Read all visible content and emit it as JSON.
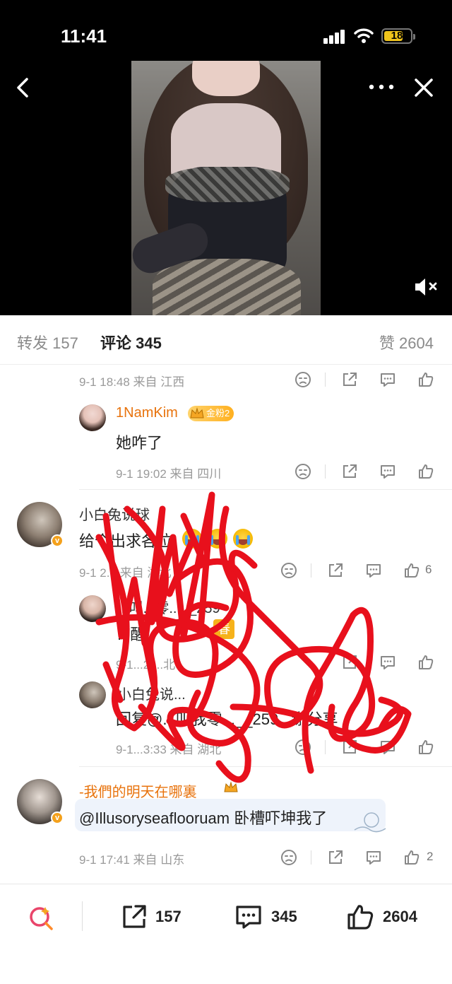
{
  "status_bar": {
    "time": "11:41",
    "battery": "18"
  },
  "tabs": {
    "repost": {
      "label": "转发",
      "count": "157"
    },
    "comments": {
      "label": "评论",
      "count": "345"
    },
    "likes": {
      "label": "赞",
      "count": "2604"
    }
  },
  "comments": [
    {
      "meta": "9-1 18:48 来自 江西"
    },
    {
      "user": "1NamKim",
      "fan_badge": "金粉2",
      "text": "她咋了",
      "meta": "9-1 19:02 来自 四川"
    },
    {
      "user": "小白兔说球",
      "text": "给个出求各位",
      "meta": "9-1 2... 来自 湖北",
      "likes": "6",
      "replies": [
        {
          "user": "...叫...零...__259",
          "text": "...醒",
          "meta": "9-1...2 ...北"
        },
        {
          "user": "小白兔说...",
          "text": "回复@...叫我零...__259...谢分享",
          "meta": "9-1...3:33 来自 湖北"
        }
      ]
    },
    {
      "user": "-我們的明天在哪裏",
      "text": "@Illusoryseaflooruam 卧槽吓坤我了",
      "meta": "9-1 17:41 来自 山东",
      "likes": "2"
    }
  ],
  "bottom_bar": {
    "repost_count": "157",
    "comment_count": "345",
    "like_count": "2604"
  },
  "colors": {
    "accent_orange": "#e8730d",
    "fan_gold": "#ffb020",
    "scribble_red": "#e8101c"
  }
}
